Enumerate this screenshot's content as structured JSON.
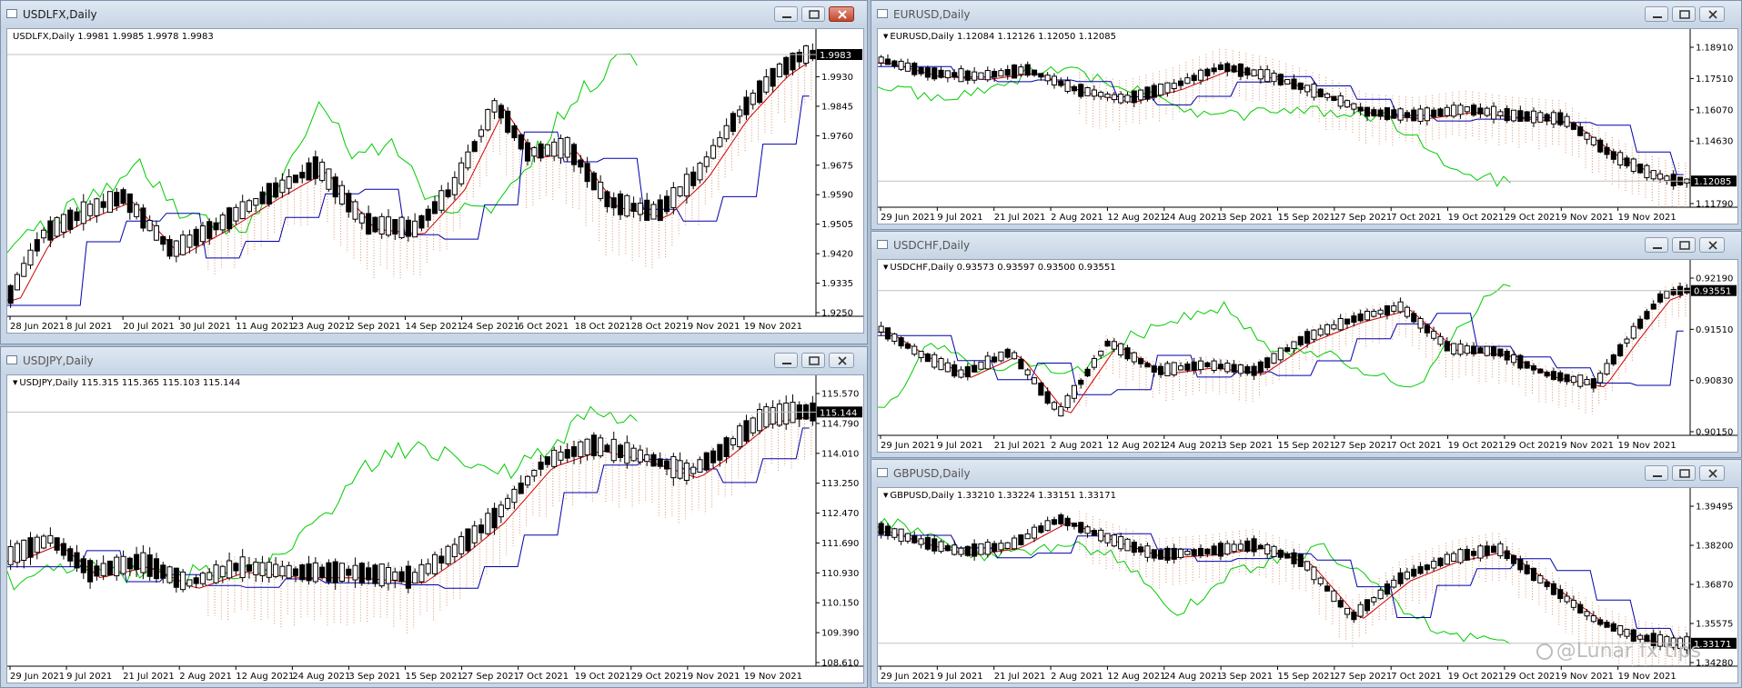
{
  "windows": [
    {
      "id": "usdlfx",
      "title": "USDLFX,Daily",
      "active": true,
      "info": "USDLFX,Daily  1.9981 1.9985 1.9978 1.9983",
      "info_arrow": false,
      "price_label": "1.9983",
      "y_ticks": [
        "2.0015",
        "1.9930",
        "1.9845",
        "1.9760",
        "1.9675",
        "1.9590",
        "1.9505",
        "1.9420",
        "1.9335",
        "1.9250"
      ],
      "x_ticks": [
        "28 Jun 2021",
        "8 Jul 2021",
        "20 Jul 2021",
        "30 Jul 2021",
        "11 Aug 2021",
        "23 Aug 2021",
        "2 Sep 2021",
        "14 Sep 2021",
        "24 Sep 2021",
        "6 Oct 2021",
        "18 Oct 2021",
        "28 Oct 2021",
        "9 Nov 2021",
        "19 Nov 2021"
      ],
      "colors": {
        "price_line": "#000000",
        "tenkan": "#cc0000",
        "kijun": "#0000aa",
        "chikou": "#00cc00",
        "kumo": "#d9906a"
      }
    },
    {
      "id": "usdjpy",
      "title": "USDJPY,Daily",
      "active": false,
      "info": "USDJPY,Daily  115.315 115.365 115.103 115.144",
      "info_arrow": true,
      "price_label": "115.144",
      "y_ticks": [
        "115.570",
        "114.790",
        "114.010",
        "113.250",
        "112.470",
        "111.690",
        "110.930",
        "110.150",
        "109.390",
        "108.610"
      ],
      "x_ticks": [
        "29 Jun 2021",
        "9 Jul 2021",
        "21 Jul 2021",
        "2 Aug 2021",
        "12 Aug 2021",
        "24 Aug 2021",
        "3 Sep 2021",
        "15 Sep 2021",
        "27 Sep 2021",
        "7 Oct 2021",
        "19 Oct 2021",
        "29 Oct 2021",
        "9 Nov 2021",
        "19 Nov 2021"
      ],
      "colors": {
        "price_line": "#000000",
        "tenkan": "#cc0000",
        "kijun": "#0000aa",
        "chikou": "#00cc00",
        "kumo": "#d9906a"
      }
    },
    {
      "id": "eurusd",
      "title": "EURUSD,Daily",
      "active": false,
      "info": "EURUSD,Daily  1.12084 1.12126 1.12050 1.12085",
      "info_arrow": true,
      "price_label": "1.12085",
      "y_ticks": [
        "1.18910",
        "1.17510",
        "1.16070",
        "1.14630",
        "1.13190",
        "1.11790"
      ],
      "x_ticks": [
        "29 Jun 2021",
        "9 Jul 2021",
        "21 Jul 2021",
        "2 Aug 2021",
        "12 Aug 2021",
        "24 Aug 2021",
        "3 Sep 2021",
        "15 Sep 2021",
        "27 Sep 2021",
        "7 Oct 2021",
        "19 Oct 2021",
        "29 Oct 2021",
        "9 Nov 2021",
        "19 Nov 2021"
      ],
      "colors": {
        "price_line": "#000000",
        "tenkan": "#cc0000",
        "kijun": "#0000aa",
        "chikou": "#00cc00",
        "kumo": "#d9906a"
      }
    },
    {
      "id": "usdchf",
      "title": "USDCHF,Daily",
      "active": false,
      "info": "USDCHF,Daily  0.93573 0.93597 0.93500 0.93551",
      "info_arrow": true,
      "price_label": "0.93551",
      "y_ticks": [
        "0.92190",
        "0.91510",
        "0.90830",
        "0.90150"
      ],
      "x_ticks": [
        "29 Jun 2021",
        "9 Jul 2021",
        "21 Jul 2021",
        "2 Aug 2021",
        "12 Aug 2021",
        "24 Aug 2021",
        "3 Sep 2021",
        "15 Sep 2021",
        "27 Sep 2021",
        "7 Oct 2021",
        "19 Oct 2021",
        "29 Oct 2021",
        "9 Nov 2021",
        "19 Nov 2021"
      ],
      "colors": {
        "price_line": "#000000",
        "tenkan": "#cc0000",
        "kijun": "#0000aa",
        "chikou": "#00cc00",
        "kumo": "#d9906a"
      }
    },
    {
      "id": "gbpusd",
      "title": "GBPUSD,Daily",
      "active": false,
      "info": "GBPUSD,Daily  1.33210 1.33224 1.33151 1.33171",
      "info_arrow": true,
      "price_label": "1.33171",
      "y_ticks": [
        "1.39495",
        "1.38200",
        "1.36870",
        "1.35575",
        "1.34280"
      ],
      "x_ticks": [
        "29 Jun 2021",
        "9 Jul 2021",
        "21 Jul 2021",
        "2 Aug 2021",
        "12 Aug 2021",
        "24 Aug 2021",
        "3 Sep 2021",
        "15 Sep 2021",
        "27 Sep 2021",
        "7 Oct 2021",
        "19 Oct 2021",
        "29 Oct 2021",
        "9 Nov 2021",
        "19 Nov 2021"
      ],
      "colors": {
        "price_line": "#000000",
        "tenkan": "#cc0000",
        "kijun": "#0000aa",
        "chikou": "#00cc00",
        "kumo": "#d9906a"
      }
    }
  ],
  "watermark": "@Lunar fx tips"
}
